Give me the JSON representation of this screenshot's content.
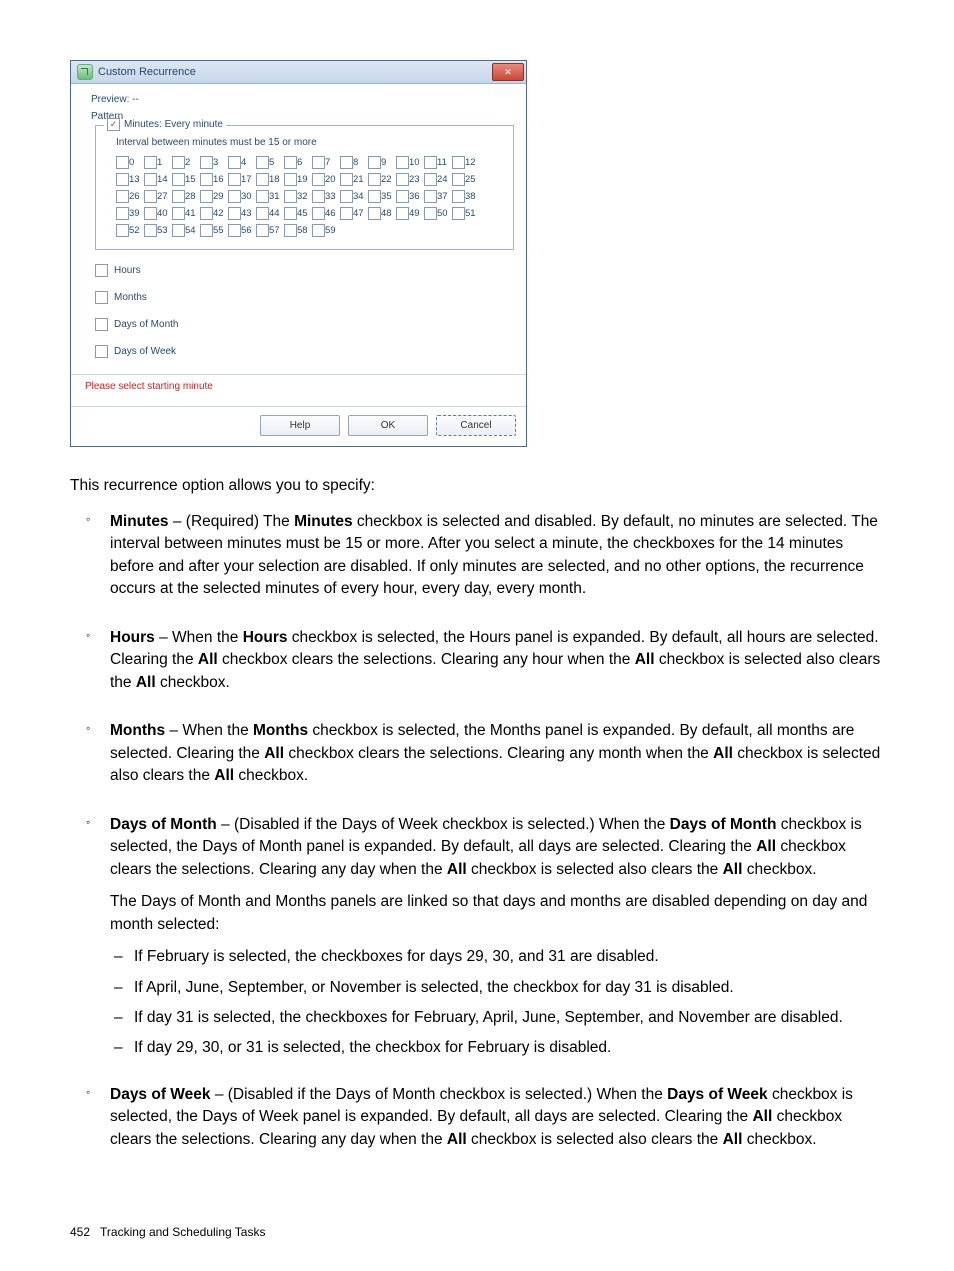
{
  "dialog": {
    "title": "Custom Recurrence",
    "preview": "Preview: --",
    "pattern": "Pattern",
    "minutes_legend": "Minutes: Every minute",
    "interval_msg": "Interval between minutes must be 15 or more",
    "minutes": [
      "0",
      "1",
      "2",
      "3",
      "4",
      "5",
      "6",
      "7",
      "8",
      "9",
      "10",
      "11",
      "12",
      "13",
      "14",
      "15",
      "16",
      "17",
      "18",
      "19",
      "20",
      "21",
      "22",
      "23",
      "24",
      "25",
      "26",
      "27",
      "28",
      "29",
      "30",
      "31",
      "32",
      "33",
      "34",
      "35",
      "36",
      "37",
      "38",
      "39",
      "40",
      "41",
      "42",
      "43",
      "44",
      "45",
      "46",
      "47",
      "48",
      "49",
      "50",
      "51",
      "52",
      "53",
      "54",
      "55",
      "56",
      "57",
      "58",
      "59"
    ],
    "opt_hours": "Hours",
    "opt_months": "Months",
    "opt_dom": "Days of Month",
    "opt_dow": "Days of Week",
    "error": "Please select starting minute",
    "btn_help": "Help",
    "btn_ok": "OK",
    "btn_cancel": "Cancel"
  },
  "intro": "This recurrence option allows you to specify:",
  "bullets": {
    "minutes": {
      "label": "Minutes",
      "sep": " – ",
      "text1": "(Required) The ",
      "bold1": "Minutes",
      "text2": " checkbox is selected and disabled. By default, no minutes are selected. The interval between minutes must be 15 or more. After you select a minute, the checkboxes for the 14 minutes before and after your selection are disabled. If only minutes are selected, and no other options, the recurrence occurs at the selected minutes of every hour, every day, every month."
    },
    "hours": {
      "label": "Hours",
      "sep": " – ",
      "text1": "When the ",
      "bold1": "Hours",
      "text2": " checkbox is selected, the Hours panel is expanded. By default, all hours are selected. Clearing the ",
      "bold2": "All",
      "text3": " checkbox clears the selections. Clearing any hour when the ",
      "bold3": "All",
      "text4": " checkbox is selected also clears the ",
      "bold4": "All",
      "text5": " checkbox."
    },
    "months": {
      "label": "Months",
      "sep": " – ",
      "text1": "When the ",
      "bold1": "Months",
      "text2": " checkbox is selected, the Months panel is expanded. By default, all months are selected. Clearing the ",
      "bold2": "All",
      "text3": " checkbox clears the selections. Clearing any month when the ",
      "bold3": "All",
      "text4": " checkbox is selected also clears the ",
      "bold4": "All",
      "text5": " checkbox."
    },
    "dom": {
      "label": "Days of Month",
      "sep": " – ",
      "text1": "(Disabled if the Days of Week checkbox is selected.) When the ",
      "bold1": "Days of Month",
      "text2": " checkbox is selected, the Days of Month panel is expanded. By default, all days are selected. Clearing the ",
      "bold2": "All",
      "text3": " checkbox clears the selections. Clearing any day when the ",
      "bold3": "All",
      "text4": " checkbox is selected also clears the ",
      "bold4": "All",
      "text5": " checkbox.",
      "link_para": "The Days of Month and Months panels are linked so that days and months are disabled depending on day and month selected:",
      "sub": [
        "If February is selected, the checkboxes for days 29, 30, and 31 are disabled.",
        "If April, June, September, or November is selected, the checkbox for day 31 is disabled.",
        "If day 31 is selected, the checkboxes for February, April, June, September, and November are disabled.",
        "If day 29, 30, or 31 is selected, the checkbox for February is disabled."
      ]
    },
    "dow": {
      "label": "Days of Week",
      "sep": " – ",
      "text1": "(Disabled if the Days of Month checkbox is selected.) When the ",
      "bold1": "Days of Week",
      "text2": " checkbox is selected, the Days of Week panel is expanded. By default, all days are selected. Clearing the ",
      "bold2": "All",
      "text3": " checkbox clears the selections. Clearing any day when the ",
      "bold3": "All",
      "text4": " checkbox is selected also clears the ",
      "bold4": "All",
      "text5": " checkbox."
    }
  },
  "footer": {
    "page": "452",
    "title": "Tracking and Scheduling Tasks"
  }
}
